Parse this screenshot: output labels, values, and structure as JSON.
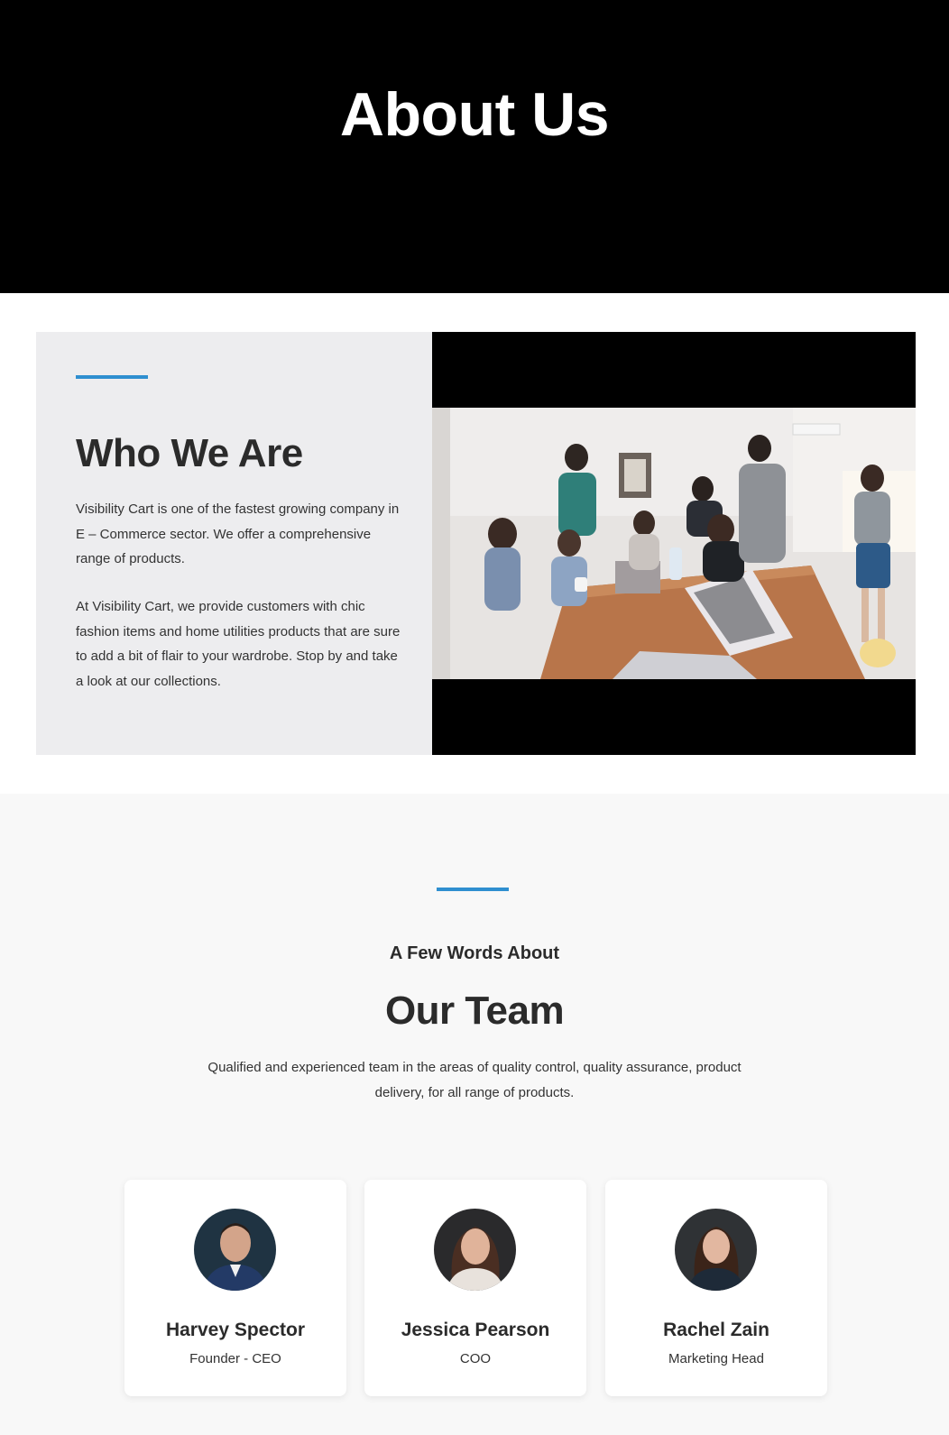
{
  "hero": {
    "title": "About Us"
  },
  "who": {
    "title": "Who We Are",
    "paragraphs": [
      "Visibility Cart is one of the fastest growing company in E – Commerce sector. We offer a comprehensive range of products.",
      "At Visibility Cart, we provide customers with chic fashion items and home utilities products that are sure to add a bit of flair to your wardrobe. Stop by and take a look at our collections."
    ]
  },
  "team": {
    "kicker": "A Few Words About",
    "title": "Our Team",
    "description": "Qualified and experienced team in the areas of quality control, quality assurance, product delivery, for all range of products.",
    "members": [
      {
        "name": "Harvey Spector",
        "role": "Founder - CEO"
      },
      {
        "name": "Jessica Pearson",
        "role": "COO"
      },
      {
        "name": "Rachel Zain",
        "role": "Marketing Head"
      }
    ]
  },
  "colors": {
    "accent": "#2f8fd0",
    "hero_bg": "#000000",
    "panel_bg": "#ededef",
    "section_bg": "#f8f8f8"
  }
}
